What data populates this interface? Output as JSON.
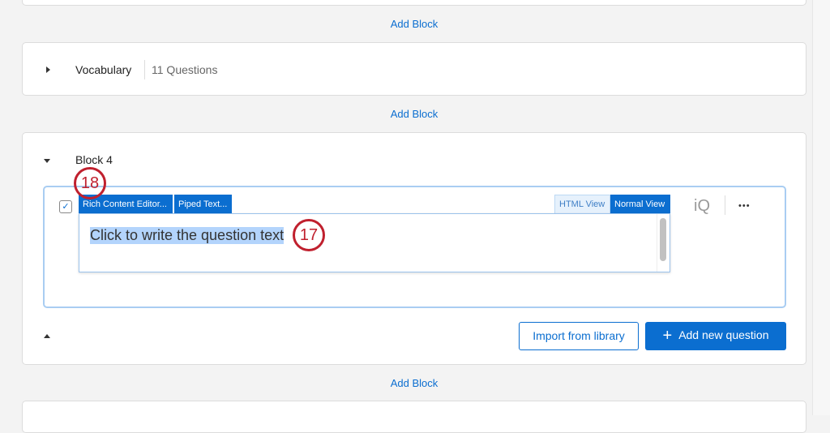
{
  "add_block_label": "Add Block",
  "blocks": [
    {
      "name": "Vocabulary",
      "count": "11 Questions"
    },
    {
      "name": "Block 4"
    }
  ],
  "question": {
    "toolbar": {
      "rich_content": "Rich Content Editor...",
      "piped_text": "Piped Text...",
      "html_view": "HTML View",
      "normal_view": "Normal View"
    },
    "text": "Click to write the question text",
    "iq_label": "iQ",
    "more_label": "•••"
  },
  "annotations": {
    "a18": "18",
    "a17": "17"
  },
  "buttons": {
    "import": "Import from library",
    "add_question": "Add new question",
    "plus": "+"
  },
  "colors": {
    "accent": "#0b6ed0",
    "annotation": "#c0202e",
    "selection": "#b3d4fc"
  }
}
